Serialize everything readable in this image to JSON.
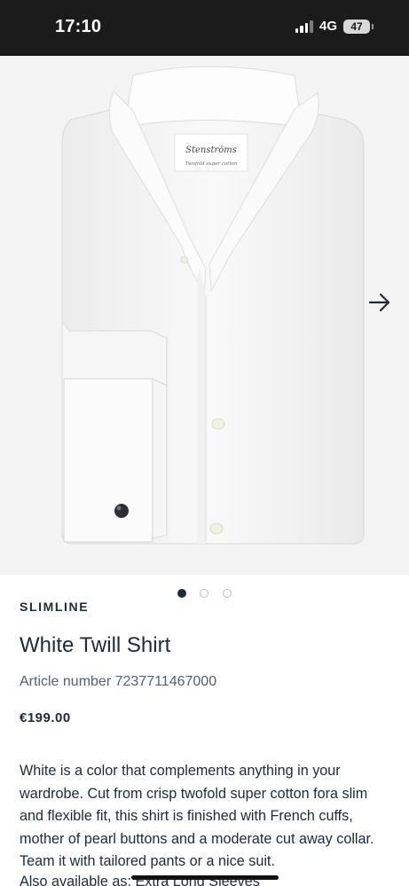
{
  "status_bar": {
    "time": "17:10",
    "network": "4G",
    "battery": "47"
  },
  "gallery": {
    "shirt_label_brand": "Stenströms",
    "shirt_label_tagline": "Twofold super cotton",
    "next_icon": "arrow-right-icon",
    "pager": {
      "count": 3,
      "active_index": 0
    }
  },
  "product": {
    "brand_line": "SLIMLINE",
    "title": "White Twill Shirt",
    "article_number": "Article number 7237711467000",
    "price": "€199.00",
    "description": "White is a color that complements anything in your wardrobe. Cut from crisp twofold super cotton fora slim and flexible fit, this shirt is finished with French cuffs, mother of pearl buttons and a moderate cut away collar. Team it with tailored pants or a nice suit.",
    "also_available_label": "Also available as:",
    "also_available_link": "Extra Long Sleeves"
  },
  "colors": {
    "text": "#1c2b39",
    "status_bar": "#1b1b1b",
    "gallery_bg": "#f4f4f4"
  }
}
